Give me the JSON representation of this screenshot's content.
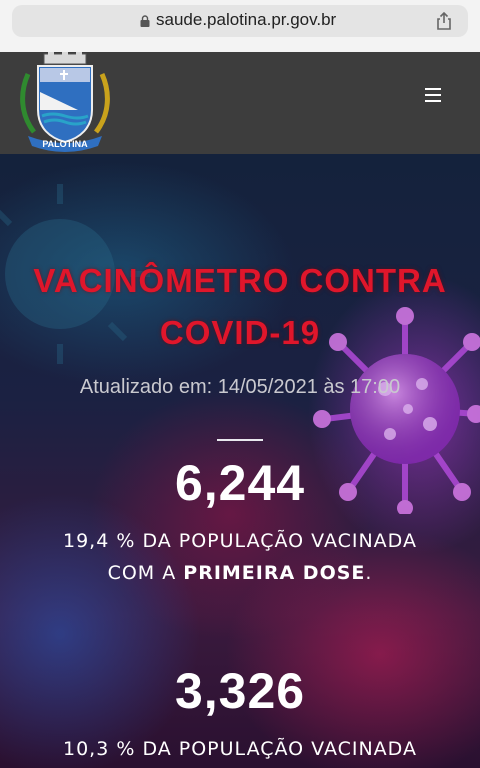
{
  "browser": {
    "url": "saude.palotina.pr.gov.br",
    "lock_icon": "lock-icon",
    "share_icon": "share-icon"
  },
  "header": {
    "logo_text": "PALOTINA",
    "menu_icon": "hamburger-menu-icon",
    "background": "#3d3d3d"
  },
  "hero": {
    "title_line1": "VACINÔMETRO CONTRA",
    "title_line2": "COVID-19",
    "updated": "Atualizado em: 14/05/2021 às 17:00",
    "title_color": "#e0162b"
  },
  "stats": [
    {
      "value": "6,244",
      "line1": "19,4 % DA POPULAÇÃO VACINADA",
      "line2_prefix": "COM A ",
      "line2_bold": "PRIMEIRA DOSE",
      "line2_suffix": "."
    },
    {
      "value": "3,326",
      "line1": "10,3 % DA POPULAÇÃO VACINADA"
    }
  ]
}
